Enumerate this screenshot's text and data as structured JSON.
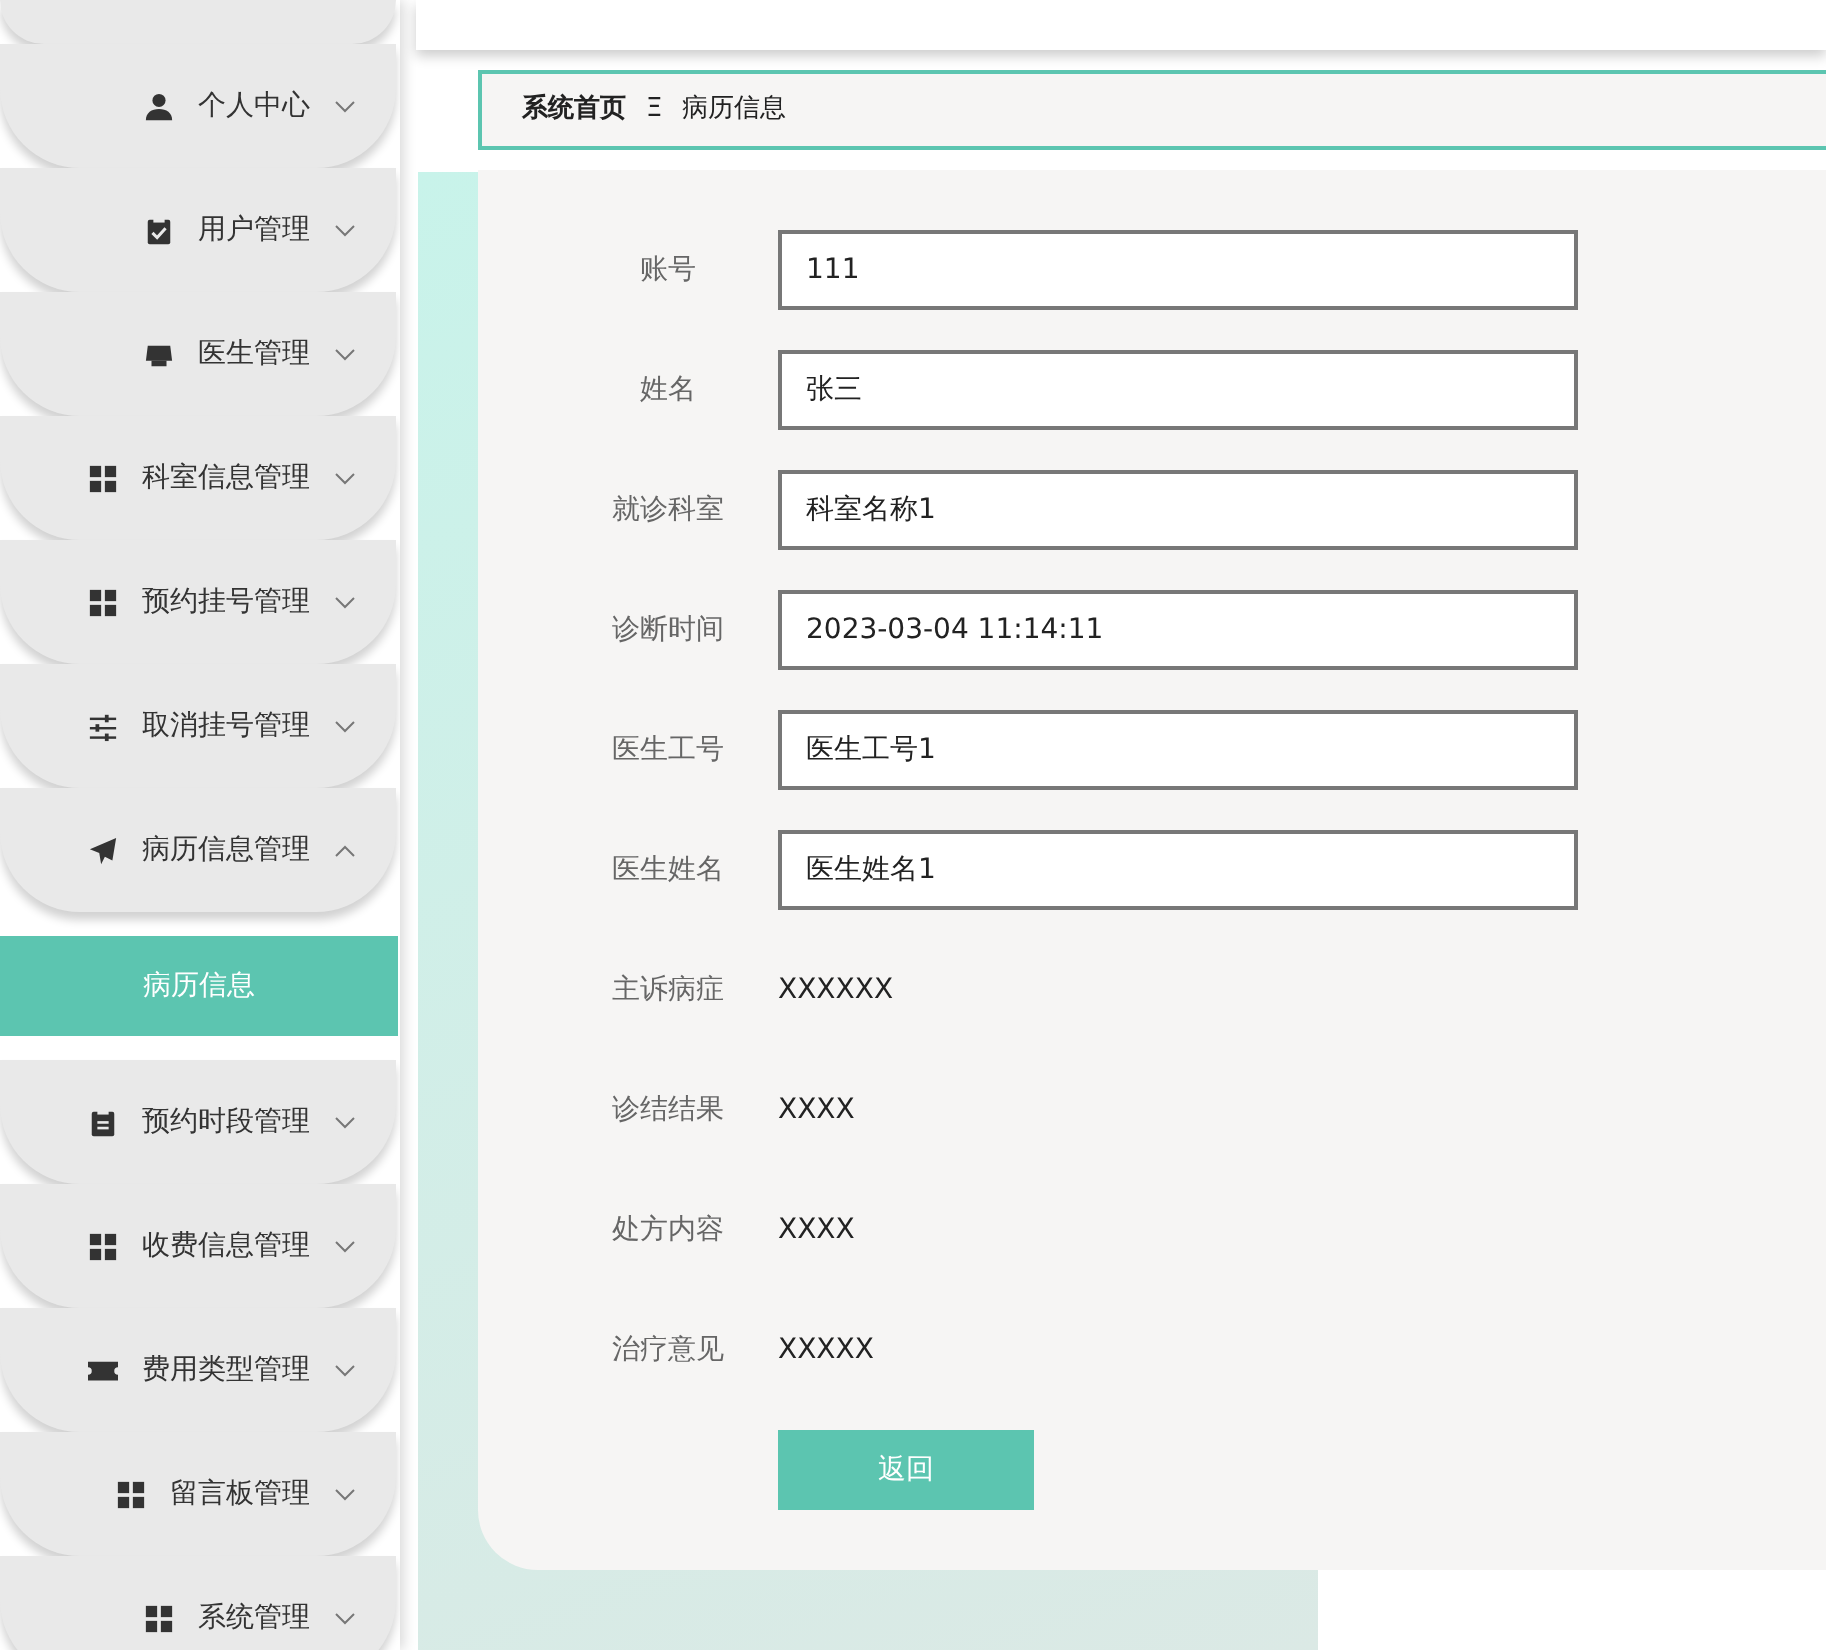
{
  "sidebar": {
    "items": [
      {
        "label": "个人中心",
        "expanded": false
      },
      {
        "label": "用户管理",
        "expanded": false
      },
      {
        "label": "医生管理",
        "expanded": false
      },
      {
        "label": "科室信息管理",
        "expanded": false
      },
      {
        "label": "预约挂号管理",
        "expanded": false
      },
      {
        "label": "取消挂号管理",
        "expanded": false
      },
      {
        "label": "病历信息管理",
        "expanded": true,
        "children": [
          {
            "label": "病历信息",
            "selected": true
          }
        ]
      },
      {
        "label": "预约时段管理",
        "expanded": false
      },
      {
        "label": "收费信息管理",
        "expanded": false
      },
      {
        "label": "费用类型管理",
        "expanded": false
      },
      {
        "label": "留言板管理",
        "expanded": false
      },
      {
        "label": "系统管理",
        "expanded": false
      }
    ]
  },
  "breadcrumb": {
    "items": [
      "系统首页",
      "病历信息"
    ],
    "separator": "Ξ"
  },
  "form": {
    "fields": [
      {
        "label": "账号",
        "kind": "input",
        "value": "111"
      },
      {
        "label": "姓名",
        "kind": "input",
        "value": "张三"
      },
      {
        "label": "就诊科室",
        "kind": "input",
        "value": "科室名称1"
      },
      {
        "label": "诊断时间",
        "kind": "input",
        "value": "2023-03-04 11:14:11"
      },
      {
        "label": "医生工号",
        "kind": "input",
        "value": "医生工号1"
      },
      {
        "label": "医生姓名",
        "kind": "input",
        "value": "医生姓名1"
      },
      {
        "label": "主诉病症",
        "kind": "text",
        "value": "XXXXXX"
      },
      {
        "label": "诊结结果",
        "kind": "text",
        "value": "XXXX"
      },
      {
        "label": "处方内容",
        "kind": "text",
        "value": "XXXX"
      },
      {
        "label": "治疗意见",
        "kind": "text",
        "value": "XXXXX"
      }
    ],
    "buttons": [
      "返回"
    ]
  }
}
